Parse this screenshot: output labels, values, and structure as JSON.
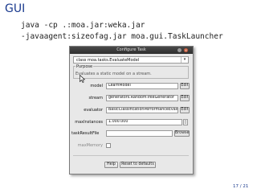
{
  "slide": {
    "title": "GUI",
    "command_lines": [
      "java -cp .:moa.jar:weka.jar",
      "-javaagent:sizeofag.jar moa.gui.TaskLauncher"
    ],
    "page_number": "17 / 21"
  },
  "dialog": {
    "title": "Configure Task",
    "class_selector": "class moa.tasks.EvaluateModel",
    "purpose_label": "Purpose",
    "purpose_text": "Evaluates a static model on a stream.",
    "fields": {
      "model": {
        "label": "model",
        "value": "LearnModel",
        "button": "Edit"
      },
      "stream": {
        "label": "stream",
        "value": "generators.RandomTreeGenerator",
        "button": "Edit"
      },
      "evaluator": {
        "label": "evaluator",
        "value": "BasicClassificationPerformanceEvaluator",
        "button": "Edit"
      },
      "maxInstances": {
        "label": "maxInstances",
        "value": "1.000.000"
      },
      "taskResultFile": {
        "label": "taskResultFile",
        "button": "Browse"
      },
      "maxMemory": {
        "label": "maxMemory"
      }
    },
    "help_button": "Help",
    "reset_button": "Reset to defaults"
  },
  "icons": {
    "minimize": "minimize-icon",
    "close": "close-icon",
    "dropdown": "chevron-down-icon",
    "cursor": "mouse-pointer-icon"
  }
}
